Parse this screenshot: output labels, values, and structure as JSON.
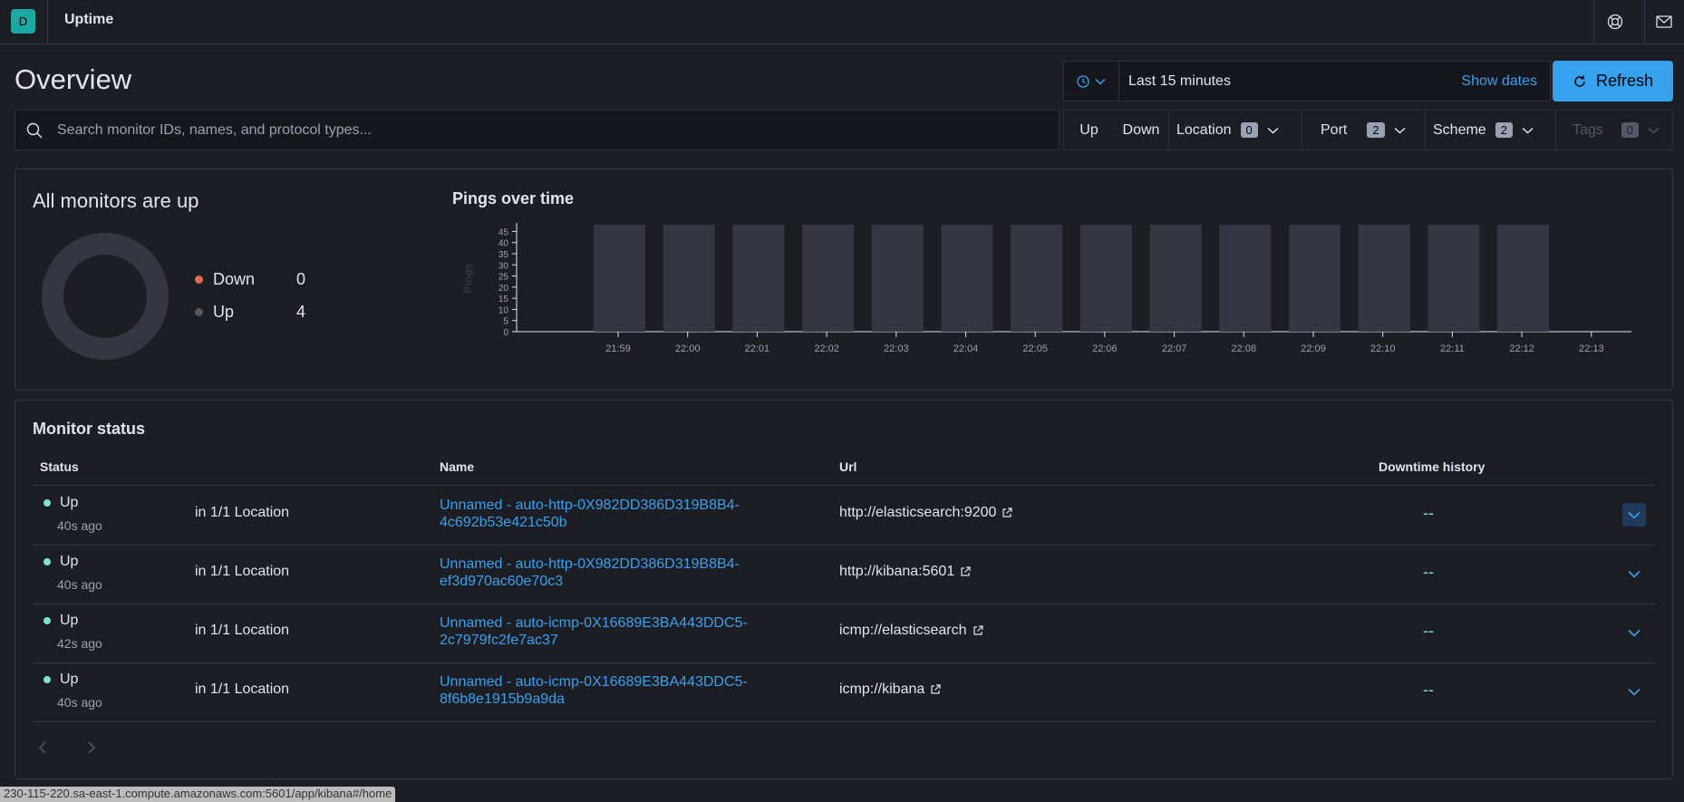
{
  "header": {
    "avatar_initial": "D",
    "app_title": "Uptime",
    "help_icon": "lifebuoy-icon",
    "mail_icon": "mail-icon"
  },
  "overview": {
    "title": "Overview",
    "datepicker": {
      "quick_icon": "clock-icon",
      "range": "Last 15 minutes",
      "show_dates": "Show dates"
    },
    "refresh_label": "Refresh"
  },
  "search": {
    "placeholder": "Search monitor IDs, names, and protocol types..."
  },
  "filters": {
    "up": "Up",
    "down": "Down",
    "location": {
      "label": "Location",
      "count": "0"
    },
    "port": {
      "label": "Port",
      "count": "2"
    },
    "scheme": {
      "label": "Scheme",
      "count": "2"
    },
    "tags": {
      "label": "Tags",
      "count": "0"
    }
  },
  "snapshot": {
    "title": "All monitors are up",
    "down_label": "Down",
    "down_count": "0",
    "up_label": "Up",
    "up_count": "4",
    "colors": {
      "down": "#e7664c",
      "up": "#535966",
      "ring": "#343741"
    }
  },
  "pings_chart": {
    "title": "Pings over time"
  },
  "chart_data": {
    "type": "bar",
    "title": "Pings over time",
    "xlabel": "",
    "ylabel": "Pings",
    "ylim": [
      0,
      48
    ],
    "yticks": [
      "0",
      "5",
      "10",
      "15",
      "20",
      "25",
      "30",
      "35",
      "40",
      "45"
    ],
    "xticks": [
      "21:59",
      "22:00",
      "22:01",
      "22:02",
      "22:03",
      "22:04",
      "22:05",
      "22:06",
      "22:07",
      "22:08",
      "22:09",
      "22:10",
      "22:11",
      "22:12",
      "22:13"
    ],
    "categories": [
      "21:58:40",
      "21:59:40",
      "22:00:40",
      "22:01:40",
      "22:02:40",
      "22:03:40",
      "22:04:40",
      "22:05:40",
      "22:06:40",
      "22:07:40",
      "22:08:40",
      "22:09:40",
      "22:10:40",
      "22:11:40"
    ],
    "values": [
      48,
      48,
      48,
      48,
      48,
      48,
      48,
      48,
      48,
      48,
      48,
      48,
      48,
      48
    ],
    "bar_color": "#343741"
  },
  "monitor_status": {
    "title": "Monitor status",
    "columns": {
      "status": "Status",
      "name": "Name",
      "url": "Url",
      "downtime": "Downtime history"
    },
    "rows": [
      {
        "status": "Up",
        "ago": "40s ago",
        "location": "in 1/1 Location",
        "name_line1": "Unnamed - auto-http-0X982DD386D319B8B4-",
        "name_line2": "4c692b53e421c50b",
        "url": "http://elasticsearch:9200",
        "downtime": "--"
      },
      {
        "status": "Up",
        "ago": "40s ago",
        "location": "in 1/1 Location",
        "name_line1": "Unnamed - auto-http-0X982DD386D319B8B4-",
        "name_line2": "ef3d970ac60e70c3",
        "url": "http://kibana:5601",
        "downtime": "--"
      },
      {
        "status": "Up",
        "ago": "42s ago",
        "location": "in 1/1 Location",
        "name_line1": "Unnamed - auto-icmp-0X16689E3BA443DDC5-",
        "name_line2": "2c7979fc2fe7ac37",
        "url": "icmp://elasticsearch",
        "downtime": "--"
      },
      {
        "status": "Up",
        "ago": "40s ago",
        "location": "in 1/1 Location",
        "name_line1": "Unnamed - auto-icmp-0X16689E3BA443DDC5-",
        "name_line2": "8f6b8e1915b9a9da",
        "url": "icmp://kibana",
        "downtime": "--"
      }
    ]
  },
  "status_bar_url": "230-115-220.sa-east-1.compute.amazonaws.com:5601/app/kibana#/home"
}
